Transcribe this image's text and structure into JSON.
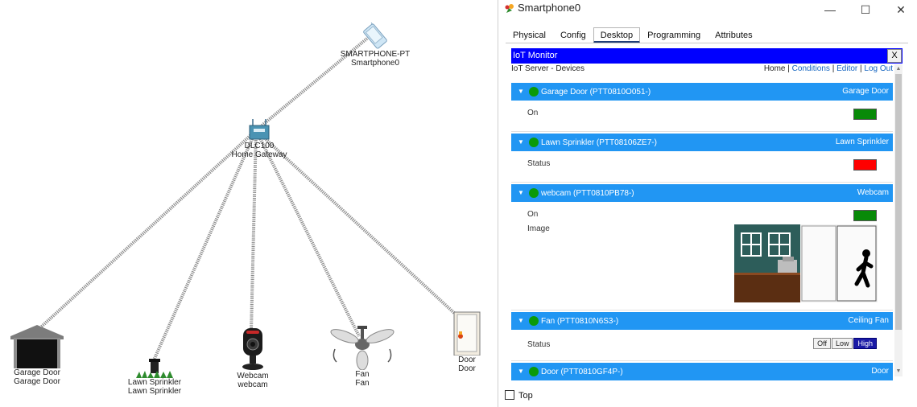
{
  "topology": {
    "smartphone": {
      "line1": "SMARTPHONE-PT",
      "line2": "Smartphone0"
    },
    "gateway": {
      "line1": "DLC100",
      "line2": "Home Gateway"
    },
    "garage": {
      "line1": "Garage Door",
      "line2": "Garage Door"
    },
    "sprinkler": {
      "line1": "Lawn Sprinkler",
      "line2": "Lawn Sprinkler"
    },
    "webcam": {
      "line1": "Webcam",
      "line2": "webcam"
    },
    "fan": {
      "line1": "Fan",
      "line2": "Fan"
    },
    "door": {
      "line1": "Door",
      "line2": "Door"
    }
  },
  "window": {
    "title": "Smartphone0",
    "minimize": "—",
    "maximize": "☐",
    "close": "✕"
  },
  "tabs": [
    "Physical",
    "Config",
    "Desktop",
    "Programming",
    "Attributes"
  ],
  "active_tab": "Desktop",
  "iot": {
    "title": "IoT Monitor",
    "close": "X",
    "server_label": "IoT Server - Devices",
    "nav": {
      "home": "Home",
      "sep": "|",
      "conditions": "Conditions",
      "editor": "Editor",
      "logout": "Log Out"
    }
  },
  "devices": [
    {
      "name": "Garage Door (PTT0810O051-)",
      "type": "Garage Door",
      "props": [
        {
          "label": "On",
          "color": "#088a08"
        }
      ]
    },
    {
      "name": "Lawn Sprinkler (PTT08106ZE7-)",
      "type": "Lawn Sprinkler",
      "props": [
        {
          "label": "Status",
          "color": "#ff0000"
        }
      ]
    },
    {
      "name": "webcam (PTT0810PB78-)",
      "type": "Webcam",
      "props": [
        {
          "label": "On",
          "color": "#088a08"
        },
        {
          "label": "Image"
        }
      ]
    },
    {
      "name": "Fan (PTT0810N6S3-)",
      "type": "Ceiling Fan",
      "props": [
        {
          "label": "Status"
        }
      ],
      "fan_buttons": [
        "Off",
        "Low",
        "High"
      ],
      "fan_selected": "High"
    },
    {
      "name": "Door (PTT0810GF4P-)",
      "type": "Door"
    }
  ],
  "bottom": {
    "top_label": "Top"
  },
  "colors": {
    "accent_bar": "#0000ff",
    "device_header": "#2196f3",
    "status_on": "#088a08",
    "status_off": "#ff0000"
  }
}
